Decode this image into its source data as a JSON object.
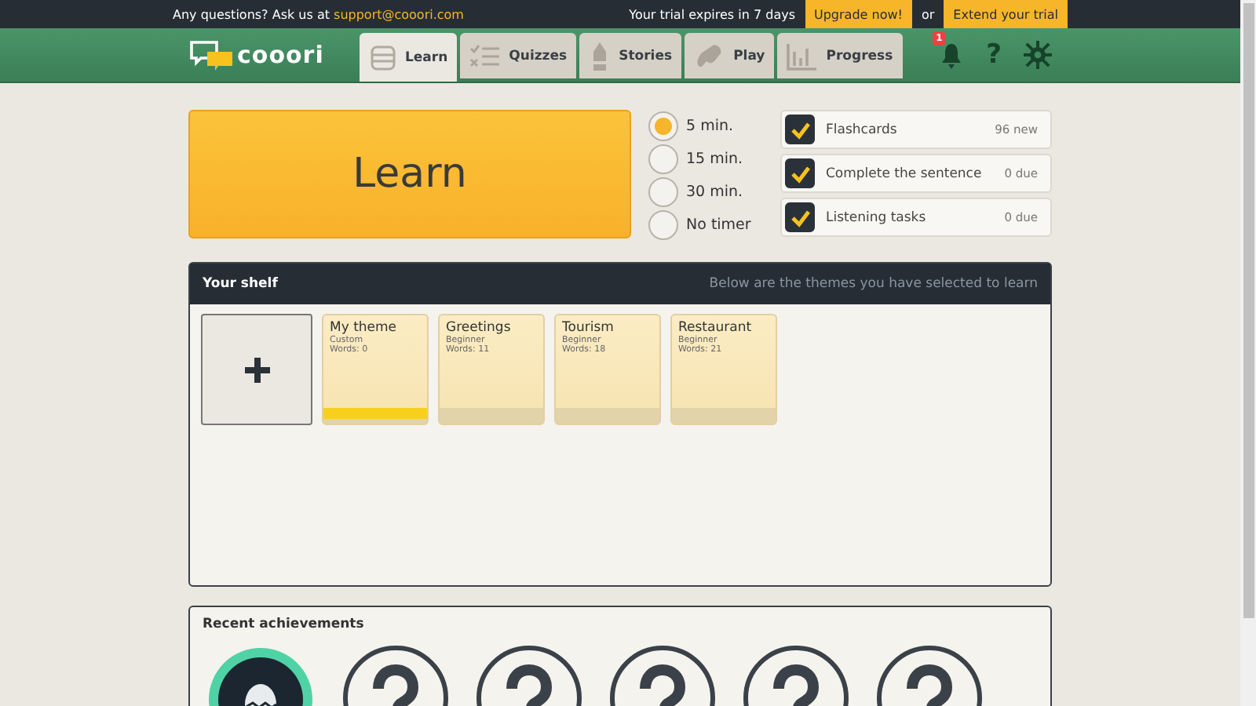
{
  "top_bar": {
    "question": "Any questions? Ask us at",
    "email": "support@cooori.com",
    "trial": "Your trial expires in 7 days",
    "upgrade": "Upgrade now!",
    "or": "or",
    "extend": "Extend your trial"
  },
  "header": {
    "logo": "cooori",
    "notification_count": "1",
    "help": "?"
  },
  "tabs": [
    {
      "label": "Learn",
      "selected": true
    },
    {
      "label": "Quizzes",
      "selected": false
    },
    {
      "label": "Stories",
      "selected": false
    },
    {
      "label": "Play",
      "selected": false
    },
    {
      "label": "Progress",
      "selected": false
    }
  ],
  "learn_button": "Learn",
  "timers": [
    {
      "label": "5 min.",
      "selected": true
    },
    {
      "label": "15 min.",
      "selected": false
    },
    {
      "label": "30 min.",
      "selected": false
    },
    {
      "label": "No timer",
      "selected": false
    }
  ],
  "tasks": [
    {
      "label": "Flashcards",
      "count": "96 new",
      "checked": true
    },
    {
      "label": "Complete the sentence",
      "count": "0 due",
      "checked": true
    },
    {
      "label": "Listening tasks",
      "count": "0 due",
      "checked": true
    }
  ],
  "shelf": {
    "title": "Your shelf",
    "subtitle": "Below are the themes you have selected to learn",
    "themes": [
      {
        "name": "My theme",
        "level_name": "Custom",
        "words": "Words: 0",
        "level": 1
      },
      {
        "name": "Greetings",
        "level_name": "Beginner",
        "words": "Words: 11",
        "level": 0
      },
      {
        "name": "Tourism",
        "level_name": "Beginner",
        "words": "Words: 18",
        "level": 0
      },
      {
        "name": "Restaurant",
        "level_name": "Beginner",
        "words": "Words: 21",
        "level": 0
      }
    ]
  },
  "achievements": {
    "title": "Recent achievements",
    "items": [
      {
        "kind": "earned"
      },
      {
        "kind": "locked"
      },
      {
        "kind": "locked"
      },
      {
        "kind": "locked"
      },
      {
        "kind": "locked"
      },
      {
        "kind": "locked"
      }
    ]
  }
}
